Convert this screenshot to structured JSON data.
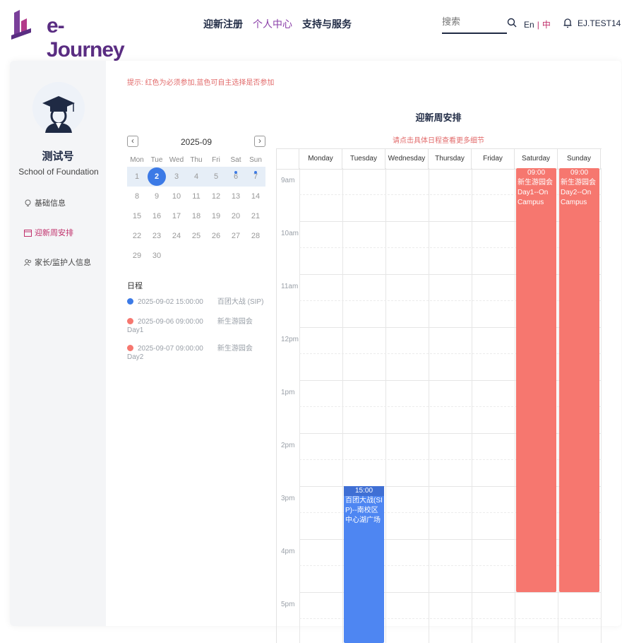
{
  "header": {
    "logo_text": "e-Journey",
    "nav": [
      "迎新注册",
      "个人中心",
      "支持与服务"
    ],
    "search_placeholder": "搜索",
    "lang_en": "En",
    "lang_sep": "|",
    "lang_zh": "中",
    "user": "EJ.TEST14"
  },
  "sidebar": {
    "name": "测试号",
    "school": "School of Foundation",
    "items": [
      {
        "label": "基础信息",
        "icon": "bulb-icon"
      },
      {
        "label": "迎新周安排",
        "icon": "calendar-icon"
      },
      {
        "label": "家长/监护人信息",
        "icon": "people-icon"
      }
    ]
  },
  "hint": "提示: 红色为必须参加,蓝色可自主选择是否参加",
  "calendar": {
    "title": "2025-09",
    "weekdays": [
      "Mon",
      "Tue",
      "Wed",
      "Thu",
      "Fri",
      "Sat",
      "Sun"
    ],
    "weeks": [
      [
        "1",
        "2",
        "3",
        "4",
        "5",
        "6",
        "7"
      ],
      [
        "8",
        "9",
        "10",
        "11",
        "12",
        "13",
        "14"
      ],
      [
        "15",
        "16",
        "17",
        "18",
        "19",
        "20",
        "21"
      ],
      [
        "22",
        "23",
        "24",
        "25",
        "26",
        "27",
        "28"
      ],
      [
        "29",
        "30",
        "",
        "",
        "",
        "",
        ""
      ]
    ],
    "selected": "2"
  },
  "schedule": {
    "title": "日程",
    "items": [
      {
        "time": "2025-09-02 15:00:00",
        "name": "百团大战 (SIP)",
        "color": "#3c7ae6"
      },
      {
        "time": "2025-09-06 09:00:00",
        "name": "新生游园会 Day1",
        "color": "#f6776f"
      },
      {
        "time": "2025-09-07 09:00:00",
        "name": "新生游园会 Day2",
        "color": "#f6776f"
      }
    ]
  },
  "week": {
    "title": "迎新周安排",
    "subtitle": "请点击具体日程查看更多细节",
    "days": [
      "Monday",
      "Tuesday",
      "Wednesday",
      "Thursday",
      "Friday",
      "Saturday",
      "Sunday"
    ],
    "times": [
      "9am",
      "10am",
      "11am",
      "12pm",
      "1pm",
      "2pm",
      "3pm",
      "4pm",
      "5pm"
    ],
    "events": [
      {
        "day": 1,
        "start": "15:00",
        "title": "百团大战(SIP)--南校区中心湖广场",
        "color": "blue"
      },
      {
        "day": 5,
        "start": "09:00",
        "title": "新生游园会Day1--On Campus",
        "color": "red"
      },
      {
        "day": 6,
        "start": "09:00",
        "title": "新生游园会Day2--On Campus",
        "color": "red"
      }
    ]
  }
}
